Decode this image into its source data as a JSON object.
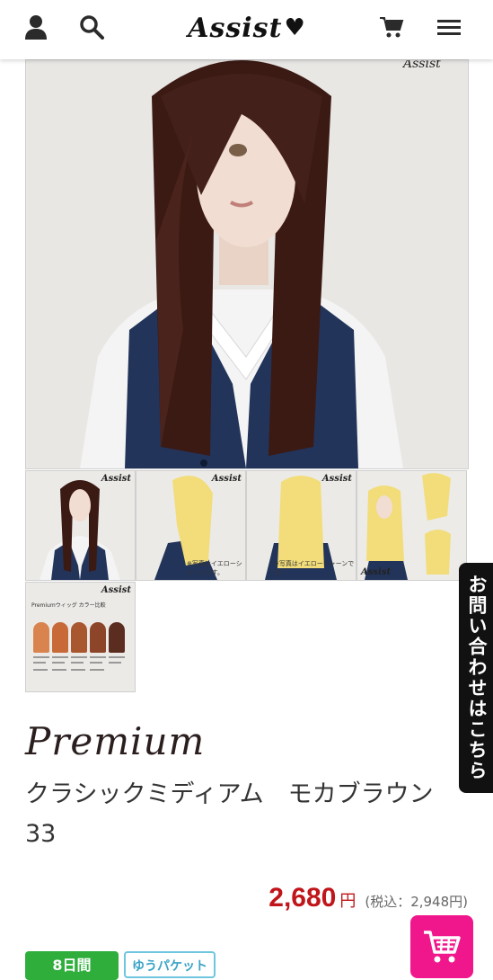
{
  "header": {
    "logo_text": "Assist",
    "icons": [
      "user-icon",
      "search-icon",
      "cart-icon",
      "menu-icon"
    ]
  },
  "gallery": {
    "main_image_alt": "Long straight mocha brown wig on mannequin",
    "thumb_logo": "Assist",
    "thumb_notes": [
      "※写真はイエローシャーンです。",
      "※写真はイエローシャーンです。"
    ],
    "chart_thumb": {
      "heading": "Premiumウィッグ カラー比較",
      "swatch_colors": [
        "#d9844e",
        "#c86a38",
        "#a9572f",
        "#8c4528",
        "#5b2d20"
      ]
    }
  },
  "product": {
    "series_label": "Premium",
    "title": "クラシックミディアム　モカブラウン　33",
    "price": "2,680",
    "price_unit": "円",
    "tax_included": "(税込：2,948円)"
  },
  "badges": {
    "shipping_days": "8日間",
    "shipping_method": "ゆうパケット"
  },
  "contact_tab": "お問い合わせはこちら",
  "colors": {
    "price_red": "#c0151a",
    "cart_pink": "#f0168c",
    "badge_green": "#2fae3c",
    "badge_blue": "#6fc6df"
  }
}
